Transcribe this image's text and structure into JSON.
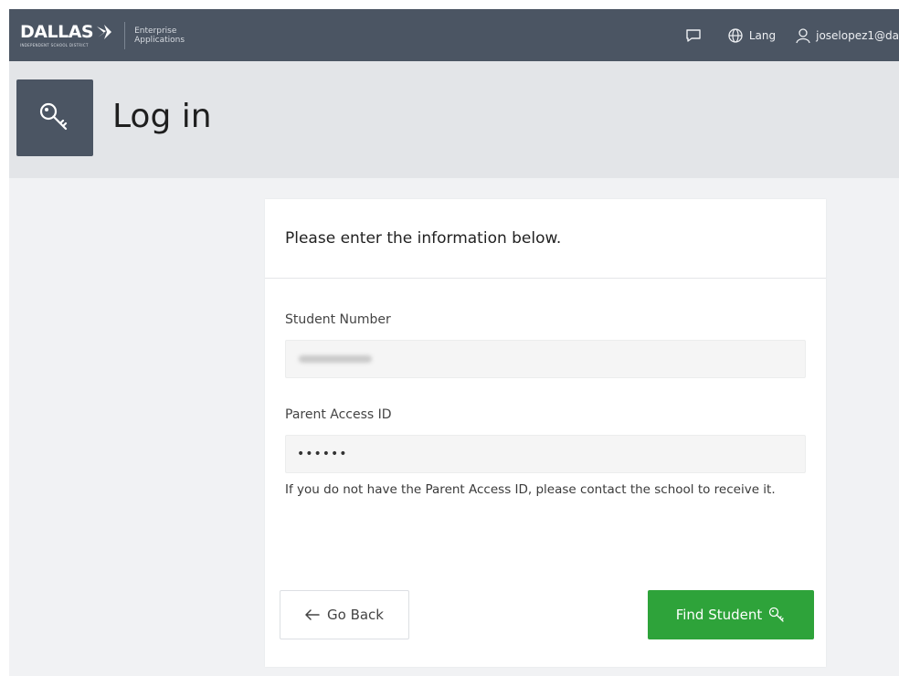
{
  "topbar": {
    "brand": "DALLAS",
    "brand_sub": "INDEPENDENT SCHOOL DISTRICT",
    "app_line1": "Enterprise",
    "app_line2": "Applications",
    "lang_label": "Lang",
    "user_label": "joselopez1@da"
  },
  "header": {
    "title": "Log in"
  },
  "card": {
    "heading": "Please enter the information below.",
    "student_number_label": "Student Number",
    "parent_access_label": "Parent Access ID",
    "parent_access_value": "••••••",
    "help_text": "If you do not have the Parent Access ID, please contact the school to receive it.",
    "back_label": "Go Back",
    "find_label": "Find Student"
  },
  "colors": {
    "topbar": "#4b5563",
    "header_bg": "#e3e5e8",
    "primary_button": "#2ea33a"
  },
  "icons": {
    "header": "key-icon",
    "feedback": "chat-bubble-icon",
    "language": "globe-icon",
    "user": "user-icon",
    "back": "arrow-left-icon",
    "find": "key-icon"
  }
}
